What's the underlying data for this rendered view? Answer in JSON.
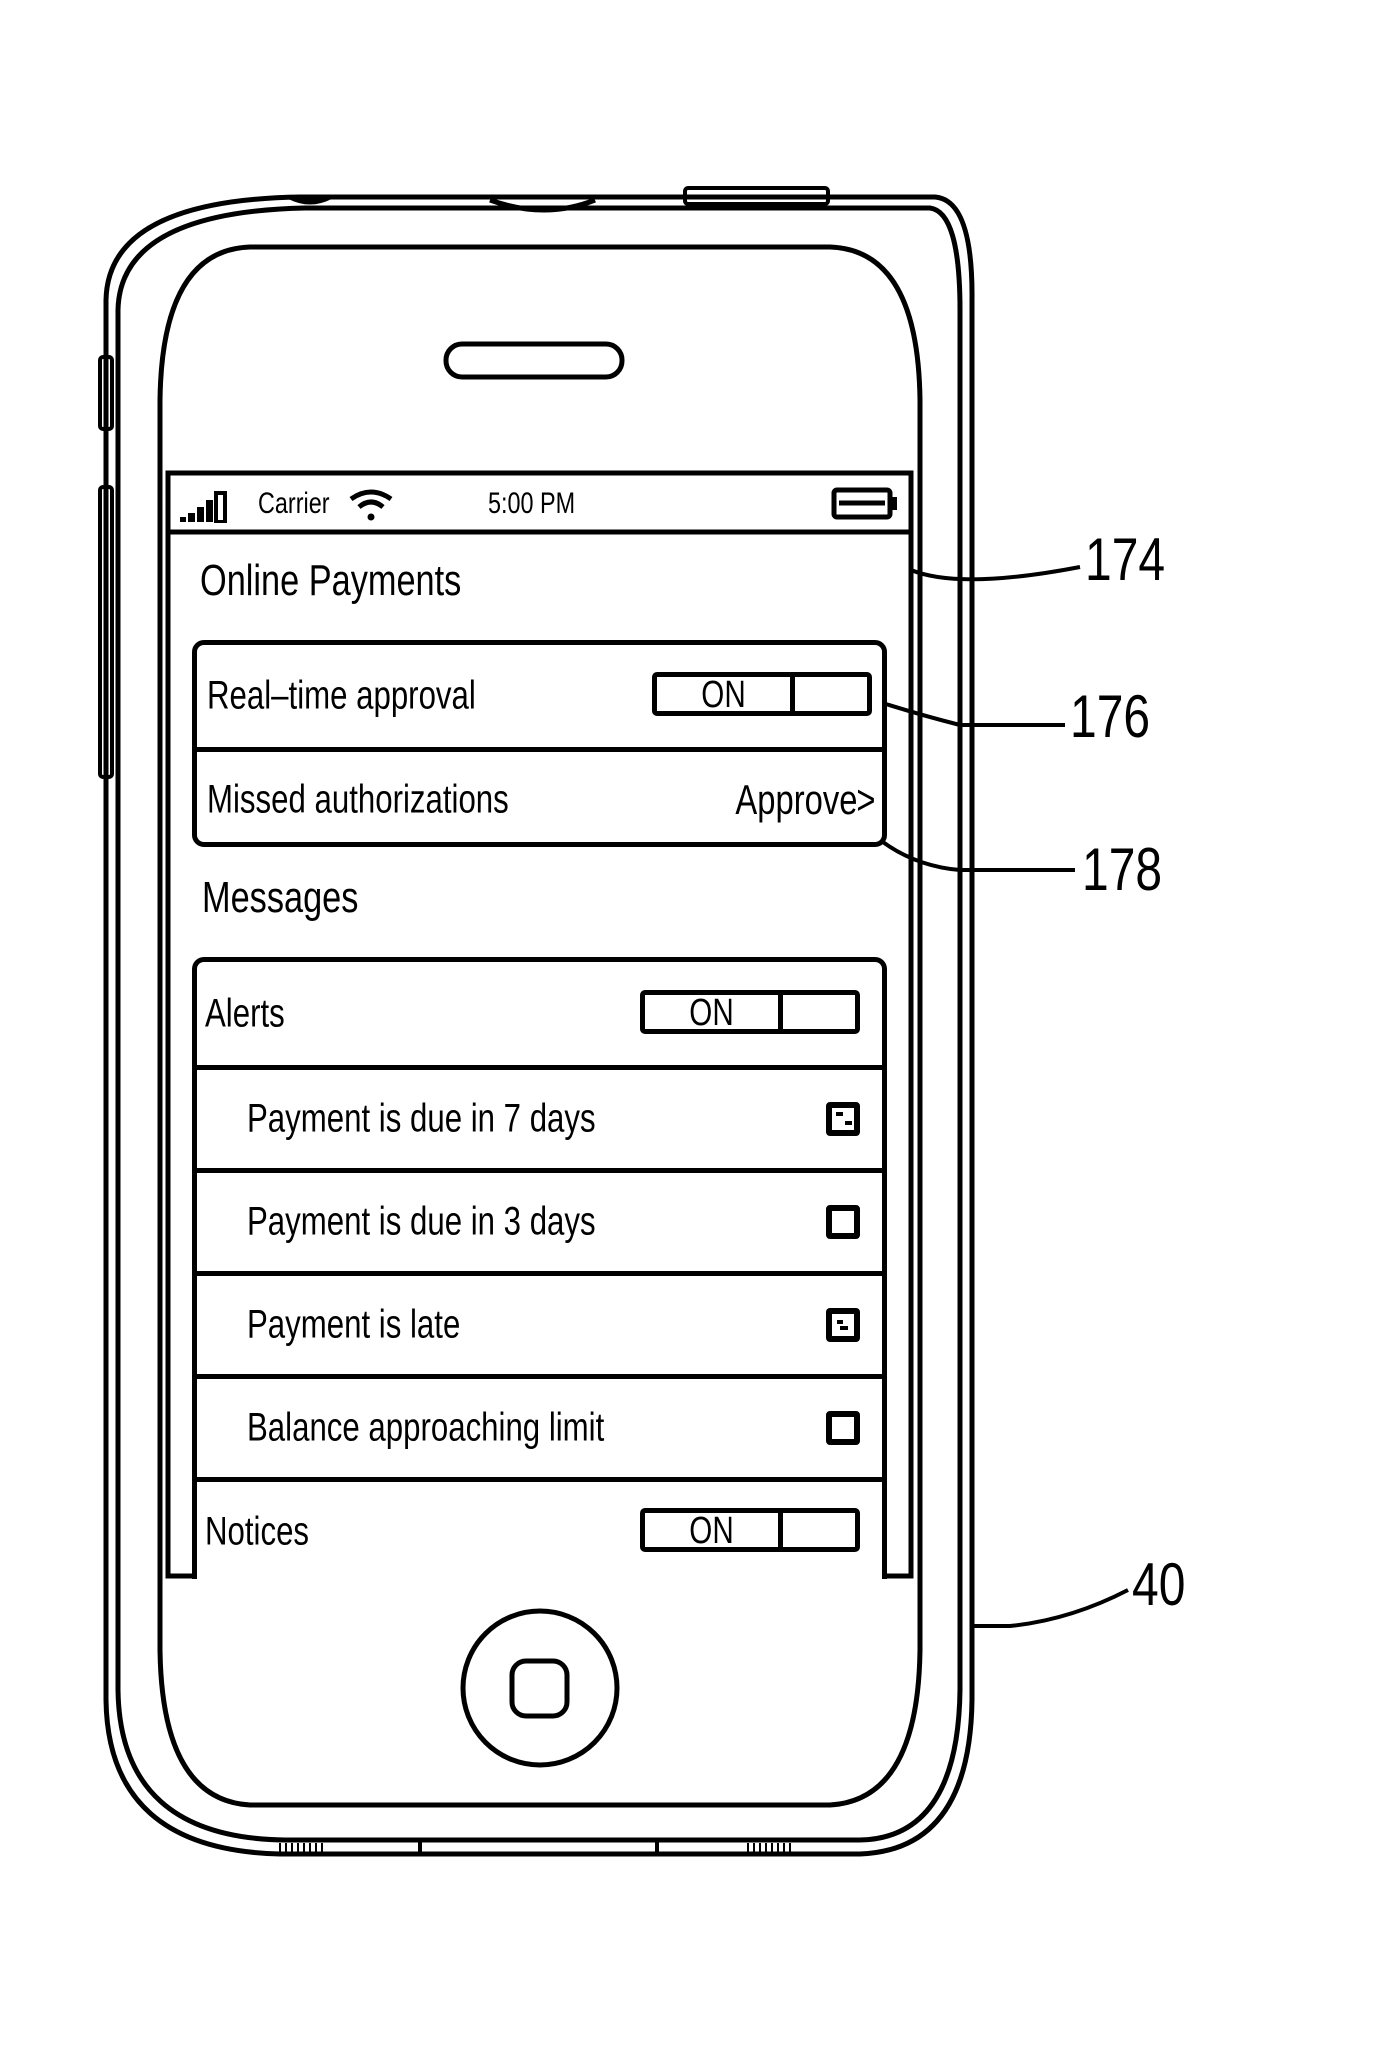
{
  "status_bar": {
    "signal_icon": "signal-bars-icon",
    "carrier": "Carrier",
    "wifi_icon": "wifi-icon",
    "time": "5:00  PM",
    "battery_icon": "battery-icon"
  },
  "online_payments": {
    "title": "Online  Payments",
    "rows": [
      {
        "label": "Real–time  approval",
        "control": "toggle",
        "toggle_label": "ON",
        "state": "on"
      },
      {
        "label": "Missed  authorizations",
        "control": "link",
        "link_label": "Approve",
        "chevron": ">"
      }
    ]
  },
  "messages": {
    "title": "Messages",
    "alerts": {
      "label": "Alerts",
      "toggle_label": "ON",
      "state": "on"
    },
    "alert_items": [
      {
        "label": "Payment is  due  in  7  days",
        "checked": true
      },
      {
        "label": "Payment is  due  in  3  days",
        "checked": false
      },
      {
        "label": "Payment is  late",
        "checked": true
      },
      {
        "label": "Balance  approaching  limit",
        "checked": false
      }
    ],
    "notices": {
      "label": "Notices",
      "toggle_label": "ON",
      "state": "on"
    }
  },
  "reference_numerals": {
    "screen": "174",
    "toggle": "176",
    "approve_link": "178",
    "device": "40"
  }
}
